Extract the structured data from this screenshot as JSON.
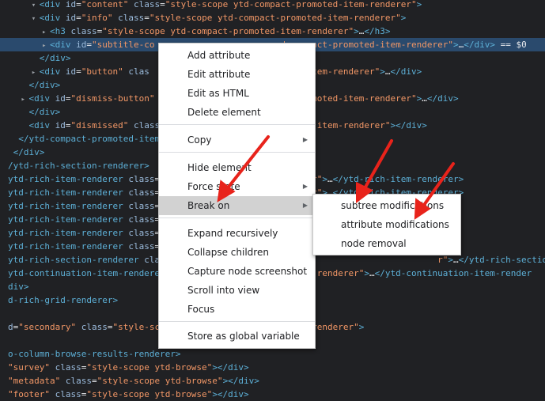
{
  "code_lines": [
    {
      "indent": "      ",
      "tri": "▾",
      "html": "<span class=\"t\">&lt;div</span> <span class=\"a\">id</span>=<span class=\"v\">\"content\"</span> <span class=\"a\">class</span>=<span class=\"v\">\"style-scope ytd-compact-promoted-item-renderer\"</span><span class=\"t\">&gt;</span>"
    },
    {
      "indent": "      ",
      "tri": "▾",
      "html": "<span class=\"t\">&lt;div</span> <span class=\"a\">id</span>=<span class=\"v\">\"info\"</span> <span class=\"a\">class</span>=<span class=\"v\">\"style-scope ytd-compact-promoted-item-renderer\"</span><span class=\"t\">&gt;</span>"
    },
    {
      "indent": "        ",
      "tri": "▸",
      "html": "<span class=\"t\">&lt;h3</span> <span class=\"a\">class</span>=<span class=\"v\">\"style-scope ytd-compact-promoted-item-renderer\"</span><span class=\"t\">&gt;</span>…<span class=\"t\">&lt;/h3&gt;</span>"
    },
    {
      "indent": "        ",
      "tri": "▸",
      "html": "<span class=\"t\">&lt;div</span> <span class=\"a\">id</span>=<span class=\"v\">\"subtitle-co</span>                        <span class=\"v\">d-compact-promoted-item-renderer\"</span><span class=\"t\">&gt;</span>…<span class=\"t\">&lt;/div&gt;</span> == $0"
    },
    {
      "indent": "      ",
      "tri": "",
      "html": "<span class=\"t\">&lt;/div&gt;</span>"
    },
    {
      "indent": "      ",
      "tri": "▸",
      "html": "<span class=\"t\">&lt;div</span> <span class=\"a\">id</span>=<span class=\"v\">\"button\"</span> <span class=\"a\">clas</span>                         <span class=\"v\">oted-item-renderer\"</span><span class=\"t\">&gt;</span>…<span class=\"t\">&lt;/div&gt;</span>"
    },
    {
      "indent": "    ",
      "tri": "",
      "html": "<span class=\"t\">&lt;/div&gt;</span>"
    },
    {
      "indent": "    ",
      "tri": "▸",
      "html": "<span class=\"t\">&lt;div</span> <span class=\"a\">id</span>=<span class=\"v\">\"dismiss-button\"</span>                         <span class=\"v\">t-promoted-item-renderer\"</span><span class=\"t\">&gt;</span>…<span class=\"t\">&lt;/div&gt;</span>"
    },
    {
      "indent": "    ",
      "tri": "",
      "html": "<span class=\"t\">&lt;/div&gt;</span>"
    },
    {
      "indent": "    ",
      "tri": "",
      "html": "<span class=\"t\">&lt;div</span> <span class=\"a\">id</span>=<span class=\"v\">\"dismissed\"</span> <span class=\"a\">class</span>                         <span class=\"v\">oted-item-renderer\"</span><span class=\"t\">&gt;&lt;/div&gt;</span>"
    },
    {
      "indent": "  ",
      "tri": "",
      "html": "<span class=\"t\">&lt;/ytd-compact-promoted-item</span>"
    },
    {
      "indent": " ",
      "tri": "",
      "html": "<span class=\"t\">&lt;/div&gt;</span>"
    },
    {
      "indent": "",
      "tri": "",
      "html": "<span class=\"t\">/ytd-rich-section-renderer&gt;</span>"
    },
    {
      "indent": "",
      "tri": "",
      "html": "<span class=\"t\">ytd-rich-item-renderer</span> <span class=\"a\">class</span>=<span class=\"v\">\"</span>                         <span class=\"v\">erer\"</span><span class=\"t\">&gt;</span>…<span class=\"t\">&lt;/ytd-rich-item-renderer&gt;</span>"
    },
    {
      "indent": "",
      "tri": "",
      "html": "<span class=\"t\">ytd-rich-item-renderer</span> <span class=\"a\">class</span>=<span class=\"v\">\"</span>                         <span class=\"v\">erer\"</span><span class=\"t\">&gt;</span>…<span class=\"t\">&lt;/ytd-rich-item-renderer&gt;</span>"
    },
    {
      "indent": "",
      "tri": "",
      "html": "<span class=\"t\">ytd-rich-item-renderer</span> <span class=\"a\">class</span>=<span class=\"v\">\"</span>"
    },
    {
      "indent": "",
      "tri": "",
      "html": "<span class=\"t\">ytd-rich-item-renderer</span> <span class=\"a\">class</span>=<span class=\"v\">\"</span>"
    },
    {
      "indent": "",
      "tri": "",
      "html": "<span class=\"t\">ytd-rich-item-renderer</span> <span class=\"a\">class</span>=<span class=\"v\">\"</span>"
    },
    {
      "indent": "",
      "tri": "",
      "html": "<span class=\"t\">ytd-rich-item-renderer</span> <span class=\"a\">class</span>=<span class=\"v\">\"</span>"
    },
    {
      "indent": "",
      "tri": "",
      "html": "<span class=\"t\">ytd-rich-section-renderer</span> <span class=\"a\">clas</span>                                                    <span class=\"v\">r\"</span><span class=\"t\">&gt;</span>…<span class=\"t\">&lt;/ytd-rich-section-renderer&gt;</span>"
    },
    {
      "indent": "",
      "tri": "",
      "html": "<span class=\"t\">ytd-continuation-item-renderer</span>                         <span class=\"v\">rid-renderer\"</span><span class=\"t\">&gt;</span>…<span class=\"t\">&lt;/ytd-continuation-item-render</span>"
    },
    {
      "indent": "",
      "tri": "",
      "html": "<span class=\"t\">div&gt;</span>"
    },
    {
      "indent": "",
      "tri": "",
      "html": "<span class=\"t\">d-rich-grid-renderer&gt;</span>"
    },
    {
      "indent": "",
      "tri": "",
      "html": ""
    },
    {
      "indent": "",
      "tri": "",
      "html": "<span class=\"a\">d</span>=<span class=\"v\">\"secondary\"</span> <span class=\"a\">class</span>=<span class=\"v\">\"style-sco</span>                         <span class=\"v\">ts-renderer\"</span><span class=\"t\">&gt;</span>"
    },
    {
      "indent": "",
      "tri": "",
      "html": ""
    },
    {
      "indent": "",
      "tri": "",
      "html": "<span class=\"t\">o-column-browse-results-renderer&gt;</span>"
    },
    {
      "indent": "",
      "tri": "",
      "html": "<span class=\"v\">\"survey\"</span> <span class=\"a\">class</span>=<span class=\"v\">\"style-scope ytd-browse\"</span><span class=\"t\">&gt;&lt;/div&gt;</span>"
    },
    {
      "indent": "",
      "tri": "",
      "html": "<span class=\"v\">\"metadata\"</span> <span class=\"a\">class</span>=<span class=\"v\">\"style-scope ytd-browse\"</span><span class=\"t\">&gt;&lt;/div&gt;</span>"
    },
    {
      "indent": "",
      "tri": "",
      "html": "<span class=\"v\">\"footer\"</span> <span class=\"a\">class</span>=<span class=\"v\">\"style-scope ytd-browse\"</span><span class=\"t\">&gt;&lt;/div&gt;</span>"
    }
  ],
  "context_menu": {
    "add_attribute": "Add attribute",
    "edit_attribute": "Edit attribute",
    "edit_as_html": "Edit as HTML",
    "delete_element": "Delete element",
    "copy": "Copy",
    "hide_element": "Hide element",
    "force_state": "Force state",
    "break_on": "Break on",
    "expand_recursively": "Expand recursively",
    "collapse_children": "Collapse children",
    "capture_node_screenshot": "Capture node screenshot",
    "scroll_into_view": "Scroll into view",
    "focus": "Focus",
    "store_as_global_variable": "Store as global variable"
  },
  "break_on_submenu": {
    "subtree_modifications": "subtree modifications",
    "attribute_modifications": "attribute modifications",
    "node_removal": "node removal"
  },
  "colors": {
    "background": "#202124",
    "tag": "#5db0d7",
    "attribute": "#9bbbdc",
    "value": "#f29766",
    "selected_row": "#2a4a6d",
    "arrow": "#e8231b"
  }
}
